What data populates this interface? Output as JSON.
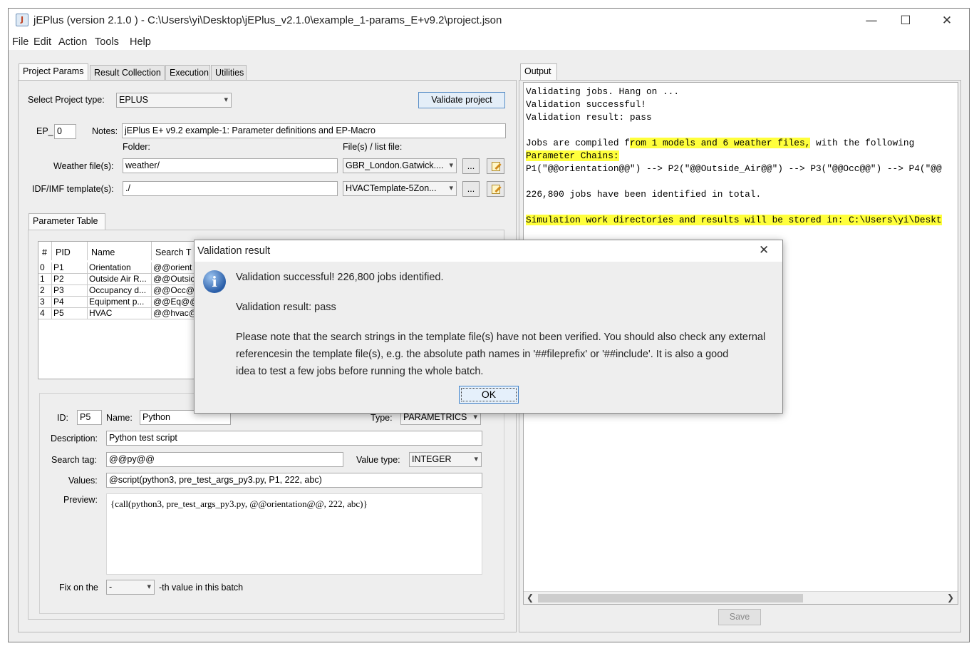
{
  "window": {
    "title": "jEPlus (version 2.1.0 )  - C:\\Users\\yi\\Desktop\\jEPlus_v2.1.0\\example_1-params_E+v9.2\\project.json",
    "app_icon": "jeplus-icon",
    "controls": [
      "—",
      "☐",
      "✕"
    ]
  },
  "menu": [
    "File",
    "Edit",
    "Action",
    "Tools",
    "Help"
  ],
  "left_tabs": [
    "Project Params",
    "Result Collection",
    "Execution",
    "Utilities"
  ],
  "project": {
    "type_label": "Select Project type:",
    "type_value": "EPLUS",
    "validate_label": "Validate project",
    "ep_label": "EP_",
    "ep_value": "0",
    "notes_label": "Notes:",
    "notes_value": "jEPlus E+ v9.2 example-1: Parameter definitions and EP-Macro",
    "folder_label": "Folder:",
    "files_label": "File(s) / list file:",
    "weather_label": "Weather file(s):",
    "weather_folder": "weather/",
    "weather_file": "GBR_London.Gatwick....",
    "idf_label": "IDF/IMF template(s):",
    "idf_folder": "./",
    "idf_file": "HVACTemplate-5Zon...",
    "browse": "..."
  },
  "param_table": {
    "tab": "Parameter Table",
    "headers": [
      "#",
      "PID",
      "Name",
      "Search T"
    ],
    "rows": [
      [
        "0",
        "P1",
        "Orientation",
        "@@orient"
      ],
      [
        "1",
        "P2",
        "Outside Air R...",
        "@@Outsic"
      ],
      [
        "2",
        "P3",
        "Occupancy d...",
        "@@Occ@"
      ],
      [
        "3",
        "P4",
        "Equipment p...",
        "@@Eq@@"
      ],
      [
        "4",
        "P5",
        "HVAC",
        "@@hvac@"
      ]
    ]
  },
  "param_detail": {
    "id_label": "ID:",
    "id_value": "P5",
    "name_label": "Name:",
    "name_value": "Python",
    "type_label": "Type:",
    "type_value": "PARAMETRICS",
    "desc_label": "Description:",
    "desc_value": "Python test script",
    "tag_label": "Search tag:",
    "tag_value": "@@py@@",
    "vtype_label": "Value type:",
    "vtype_value": "INTEGER",
    "values_label": "Values:",
    "values_value": "@script(python3, pre_test_args_py3.py, P1, 222, abc)",
    "preview_label": "Preview:",
    "preview_value": "{call(python3, pre_test_args_py3.py, @@orientation@@, 222, abc)}",
    "fix_label": "Fix on the",
    "fix_value": "-",
    "fix_suffix": "-th value in this batch"
  },
  "output": {
    "tab": "Output",
    "l1": "Validating jobs. Hang on ...",
    "l2": "Validation successful!",
    "l3": "Validation result: pass",
    "l5a": "Jobs are compiled f",
    "l5b": "rom 1 models and 6 weather files,",
    "l5c": " with the following",
    "l6": "Parameter Chains:",
    "l7": "P1(\"@@orientation@@\") --> P2(\"@@Outside_Air@@\") --> P3(\"@@Occ@@\") --> P4(\"@@",
    "l9": "226,800 jobs have been identified in total.",
    "l11": "Simulation work directories and results will be stored in: C:\\Users\\yi\\Deskt",
    "save_label": "Save"
  },
  "dialog": {
    "title": "Validation result",
    "line1": "Validation successful! 226,800 jobs identified.",
    "line2": "Validation result: pass",
    "line3": "Please note that the search strings in the template file(s) have not been verified. You should also check any external",
    "line4": "referencesin the template file(s), e.g. the absolute path names in '##fileprefix' or '##include'. It is also a good",
    "line5": "idea to test a few jobs before running the whole batch.",
    "ok_label": "OK",
    "close": "✕"
  }
}
